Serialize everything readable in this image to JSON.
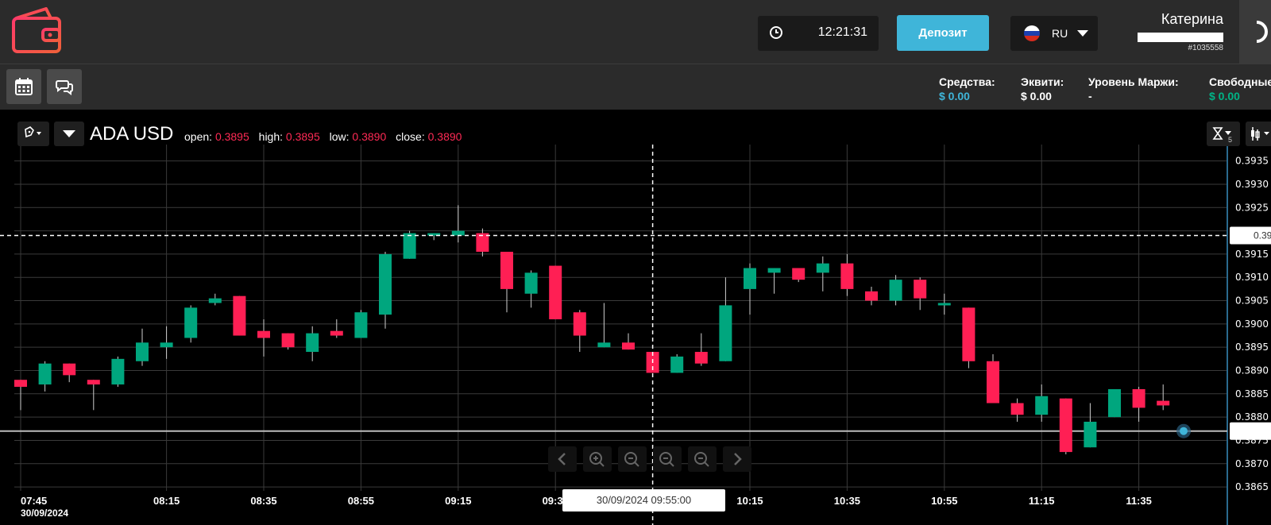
{
  "header": {
    "clock": "12:21:31",
    "deposit_label": "Депозит",
    "language": "RU",
    "user_name": "Катерина",
    "user_id": "#1035558"
  },
  "account": {
    "funds_label": "Средства:",
    "funds_value": "$ 0.00",
    "equity_label": "Эквити:",
    "equity_value": "$ 0.00",
    "margin_label": "Уровень Маржи:",
    "margin_value": "-",
    "free_label": "Свободные",
    "free_value": "$ 0.00",
    "funds_color": "#3fb5d9",
    "free_color": "#00b386"
  },
  "chart_header": {
    "symbol": "ADA USD",
    "open_label": "open:",
    "open": "0.3895",
    "high_label": "high:",
    "high": "0.3895",
    "low_label": "low:",
    "low": "0.3890",
    "close_label": "close:",
    "close": "0.3890",
    "interval_badge": "5"
  },
  "crosshair": {
    "date_label": "30/09/2024 09:55:00",
    "price_label_partial": "0.39",
    "price_value": 0.3919
  },
  "colors": {
    "up": "#00a67e",
    "down": "#ff1f54",
    "grid": "#3a3a3a",
    "axis_text": "#ffffff"
  },
  "chart_data": {
    "type": "candlestick",
    "title": "ADA USD",
    "x_tick_labels": [
      "07:45",
      "08:15",
      "08:35",
      "08:55",
      "09:15",
      "09:35",
      "10:15",
      "10:35",
      "10:55",
      "11:15",
      "11:35"
    ],
    "x_date_label": "30/09/2024",
    "y_tick_labels": [
      "0.3935",
      "0.3930",
      "0.3925",
      "0.3920",
      "0.3915",
      "0.3910",
      "0.3905",
      "0.3900",
      "0.3895",
      "0.3890",
      "0.3885",
      "0.3880",
      "0.3875",
      "0.3870",
      "0.3865"
    ],
    "ylim": [
      0.3865,
      0.3937
    ],
    "current_price_line": 0.3877,
    "candles": [
      {
        "time": "07:45",
        "open": 0.3888,
        "high": 0.3888,
        "low": 0.38815,
        "close": 0.38865
      },
      {
        "time": "07:50",
        "open": 0.3887,
        "high": 0.3892,
        "low": 0.38855,
        "close": 0.38915
      },
      {
        "time": "07:55",
        "open": 0.38915,
        "high": 0.38915,
        "low": 0.38875,
        "close": 0.3889
      },
      {
        "time": "08:00",
        "open": 0.3888,
        "high": 0.3888,
        "low": 0.38815,
        "close": 0.3887
      },
      {
        "time": "08:05",
        "open": 0.3887,
        "high": 0.3893,
        "low": 0.38865,
        "close": 0.38925
      },
      {
        "time": "08:10",
        "open": 0.3892,
        "high": 0.3899,
        "low": 0.3891,
        "close": 0.3896
      },
      {
        "time": "08:15",
        "open": 0.3895,
        "high": 0.38995,
        "low": 0.38925,
        "close": 0.3896
      },
      {
        "time": "08:20",
        "open": 0.3897,
        "high": 0.3904,
        "low": 0.3896,
        "close": 0.39035
      },
      {
        "time": "08:25",
        "open": 0.39045,
        "high": 0.39065,
        "low": 0.3904,
        "close": 0.39055
      },
      {
        "time": "08:30",
        "open": 0.3906,
        "high": 0.3906,
        "low": 0.38975,
        "close": 0.38975
      },
      {
        "time": "08:35",
        "open": 0.38985,
        "high": 0.3901,
        "low": 0.3893,
        "close": 0.3897
      },
      {
        "time": "08:40",
        "open": 0.3898,
        "high": 0.3898,
        "low": 0.38945,
        "close": 0.3895
      },
      {
        "time": "08:45",
        "open": 0.3894,
        "high": 0.38995,
        "low": 0.3892,
        "close": 0.3898
      },
      {
        "time": "08:50",
        "open": 0.38985,
        "high": 0.3901,
        "low": 0.3897,
        "close": 0.38975
      },
      {
        "time": "08:55",
        "open": 0.3897,
        "high": 0.3903,
        "low": 0.3897,
        "close": 0.39025
      },
      {
        "time": "09:00",
        "open": 0.3902,
        "high": 0.39155,
        "low": 0.3899,
        "close": 0.3915
      },
      {
        "time": "09:05",
        "open": 0.3914,
        "high": 0.392,
        "low": 0.3914,
        "close": 0.39195
      },
      {
        "time": "09:10",
        "open": 0.3919,
        "high": 0.39195,
        "low": 0.3918,
        "close": 0.39195
      },
      {
        "time": "09:15",
        "open": 0.3919,
        "high": 0.39255,
        "low": 0.39175,
        "close": 0.392
      },
      {
        "time": "09:20",
        "open": 0.39195,
        "high": 0.39205,
        "low": 0.39145,
        "close": 0.39155
      },
      {
        "time": "09:25",
        "open": 0.39155,
        "high": 0.39155,
        "low": 0.39025,
        "close": 0.39075
      },
      {
        "time": "09:30",
        "open": 0.39065,
        "high": 0.39115,
        "low": 0.39035,
        "close": 0.3911
      },
      {
        "time": "09:35",
        "open": 0.39125,
        "high": 0.39125,
        "low": 0.3901,
        "close": 0.3901
      },
      {
        "time": "09:40",
        "open": 0.39025,
        "high": 0.3903,
        "low": 0.3894,
        "close": 0.38975
      },
      {
        "time": "09:45",
        "open": 0.3895,
        "high": 0.39045,
        "low": 0.3895,
        "close": 0.3896
      },
      {
        "time": "09:50",
        "open": 0.3896,
        "high": 0.3898,
        "low": 0.38945,
        "close": 0.38945
      },
      {
        "time": "09:55",
        "open": 0.3894,
        "high": 0.3894,
        "low": 0.38895,
        "close": 0.38895
      },
      {
        "time": "10:00",
        "open": 0.38895,
        "high": 0.38935,
        "low": 0.38895,
        "close": 0.3893
      },
      {
        "time": "10:05",
        "open": 0.3894,
        "high": 0.3898,
        "low": 0.3891,
        "close": 0.38915
      },
      {
        "time": "10:10",
        "open": 0.3892,
        "high": 0.391,
        "low": 0.3892,
        "close": 0.3904
      },
      {
        "time": "10:15",
        "open": 0.39075,
        "high": 0.3913,
        "low": 0.3902,
        "close": 0.3912
      },
      {
        "time": "10:20",
        "open": 0.3911,
        "high": 0.3912,
        "low": 0.39065,
        "close": 0.3912
      },
      {
        "time": "10:25",
        "open": 0.3912,
        "high": 0.3912,
        "low": 0.3909,
        "close": 0.39095
      },
      {
        "time": "10:30",
        "open": 0.3911,
        "high": 0.39145,
        "low": 0.3907,
        "close": 0.3913
      },
      {
        "time": "10:35",
        "open": 0.3913,
        "high": 0.3915,
        "low": 0.3906,
        "close": 0.39075
      },
      {
        "time": "10:40",
        "open": 0.3907,
        "high": 0.3908,
        "low": 0.3904,
        "close": 0.3905
      },
      {
        "time": "10:45",
        "open": 0.3905,
        "high": 0.39105,
        "low": 0.3904,
        "close": 0.39095
      },
      {
        "time": "10:50",
        "open": 0.39095,
        "high": 0.391,
        "low": 0.3903,
        "close": 0.39055
      },
      {
        "time": "10:55",
        "open": 0.39045,
        "high": 0.39065,
        "low": 0.3902,
        "close": 0.39045
      },
      {
        "time": "11:00",
        "open": 0.39035,
        "high": 0.39035,
        "low": 0.38905,
        "close": 0.3892
      },
      {
        "time": "11:05",
        "open": 0.3892,
        "high": 0.38935,
        "low": 0.3883,
        "close": 0.3883
      },
      {
        "time": "11:10",
        "open": 0.3883,
        "high": 0.3884,
        "low": 0.3879,
        "close": 0.38805
      },
      {
        "time": "11:15",
        "open": 0.38805,
        "high": 0.3887,
        "low": 0.3879,
        "close": 0.38845
      },
      {
        "time": "11:20",
        "open": 0.3884,
        "high": 0.3884,
        "low": 0.3872,
        "close": 0.38725
      },
      {
        "time": "11:25",
        "open": 0.38735,
        "high": 0.3883,
        "low": 0.38735,
        "close": 0.3879
      },
      {
        "time": "11:30",
        "open": 0.388,
        "high": 0.3886,
        "low": 0.388,
        "close": 0.3886
      },
      {
        "time": "11:35",
        "open": 0.3886,
        "high": 0.38865,
        "low": 0.3879,
        "close": 0.3882
      },
      {
        "time": "11:40",
        "open": 0.38835,
        "high": 0.3887,
        "low": 0.38815,
        "close": 0.38825
      }
    ]
  }
}
